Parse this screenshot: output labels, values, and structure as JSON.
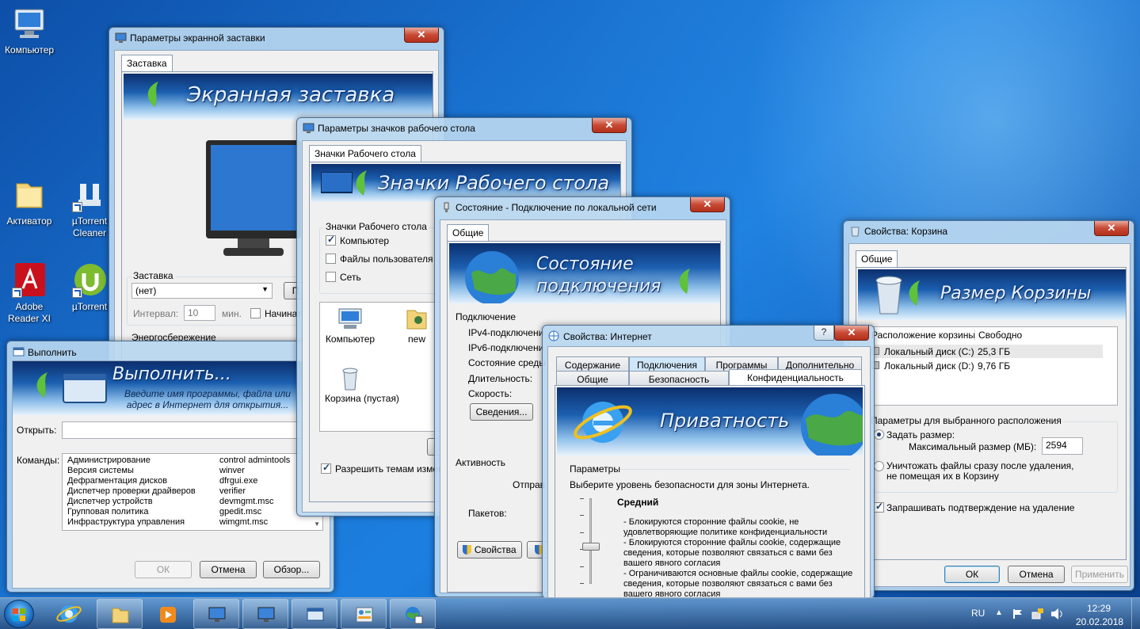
{
  "desktop": {
    "icons": [
      {
        "label": "Компьютер",
        "icon": "computer-icon"
      },
      {
        "label": "Активатор",
        "icon": "folder-icon"
      },
      {
        "label": "µTorrent Cleaner",
        "icon": "utorrent-cleaner-icon"
      },
      {
        "label": "Adobe Reader XI",
        "icon": "adobe-reader-icon"
      },
      {
        "label": "µTorrent",
        "icon": "utorrent-icon"
      }
    ]
  },
  "screensaver": {
    "title": "Параметры экранной заставки",
    "tab": "Заставка",
    "banner": "Экранная заставка",
    "group_label": "Заставка",
    "selected": "(нет)",
    "interval_label": "Интервал:",
    "interval_value": "10",
    "interval_unit": "мин.",
    "resume_label": "Начинат",
    "power_label": "Энергосбережение"
  },
  "desktop_icons": {
    "title": "Параметры значков рабочего стола",
    "tab": "Значки Рабочего стола",
    "banner": "Значки Рабочего стола",
    "group_label": "Значки Рабочего стола",
    "checkboxes": [
      {
        "label": "Компьютер",
        "checked": true
      },
      {
        "label": "Файлы пользователя",
        "checked": false
      },
      {
        "label": "Сеть",
        "checked": false
      }
    ],
    "preview": [
      {
        "label": "Компьютер"
      },
      {
        "label": "new"
      },
      {
        "label": "Корзина (пустая)"
      }
    ],
    "allow_themes": "Разрешить темам изменя"
  },
  "run": {
    "title": "Выполнить",
    "banner": "Выполнить...",
    "banner_sub": "Введите имя программы, файла или адрес в Интернет для открытия...",
    "open_label": "Открыть:",
    "commands_label": "Команды:",
    "commands": [
      {
        "name": "Администрирование",
        "cmd": "control admintools"
      },
      {
        "name": "Версия системы",
        "cmd": "winver"
      },
      {
        "name": "Дефрагментация дисков",
        "cmd": "dfrgui.exe"
      },
      {
        "name": "Диспетчер проверки драйверов",
        "cmd": "verifier"
      },
      {
        "name": "Диспетчер устройств",
        "cmd": "devmgmt.msc"
      },
      {
        "name": "Групповая политика",
        "cmd": "gpedit.msc"
      },
      {
        "name": "Инфраструктура управления",
        "cmd": "wimgmt.msc"
      }
    ],
    "ok": "ОК",
    "cancel": "Отмена",
    "browse": "Обзор..."
  },
  "network": {
    "title": "Состояние - Подключение по локальной сети",
    "tab": "Общие",
    "banner_line1": "Состояние",
    "banner_line2": "подключения",
    "conn_label": "Подключение",
    "rows": [
      "IPv4-подключени",
      "IPv6-подключени",
      "Состояние среды",
      "Длительность:",
      "Скорость:"
    ],
    "details": "Сведения...",
    "activity": "Активность",
    "sent": "Отправ",
    "packets": "Пакетов:",
    "properties": "Свойства"
  },
  "recycle": {
    "title": "Свойства: Корзина",
    "tab": "Общие",
    "banner": "Размер Корзины",
    "col_location": "Расположение корзины",
    "col_free": "Свободно",
    "drives": [
      {
        "name": "Локальный диск (C:)",
        "free": "25,3 ГБ"
      },
      {
        "name": "Локальный диск (D:)",
        "free": "9,76 ГБ"
      }
    ],
    "settings_label": "Параметры для выбранного расположения",
    "custom_size": "Задать размер:",
    "max_size_label": "Максимальный размер (МБ):",
    "max_size_value": "2594",
    "delete_now": "Уничтожать файлы сразу после удаления, не помещая их в Корзину",
    "confirm": "Запрашивать подтверждение на удаление",
    "ok": "ОК",
    "cancel": "Отмена",
    "apply": "Применить"
  },
  "internet": {
    "title": "Свойства: Интернет",
    "help": "?",
    "tabs_row1": [
      "Содержание",
      "Подключения",
      "Программы",
      "Дополнительно"
    ],
    "tabs_row2": [
      "Общие",
      "Безопасность",
      "Конфиденциальность"
    ],
    "banner": "Приватность",
    "params_label": "Параметры",
    "zone_text": "Выберите уровень безопасности для зоны Интернета.",
    "level": "Средний",
    "desc": [
      "- Блокируются сторонние файлы cookie, не удовлетворяющие политике конфиденциальности",
      "- Блокируются сторонние файлы cookie, содержащие сведения, которые позволяют связаться с вами без вашего явного согласия",
      "- Ограничиваются основные файлы cookie, содержащие сведения, которые позволяют связаться с вами без вашего явного согласия"
    ],
    "slider_level": 0.5
  },
  "taskbar": {
    "lang": "RU",
    "time": "12:29",
    "date": "20.02.2018",
    "items": [
      "explorer-icon",
      "media-player-icon",
      "display-settings-icon",
      "display-settings-icon",
      "run-icon",
      "control-panel-icon",
      "network-icon"
    ]
  }
}
